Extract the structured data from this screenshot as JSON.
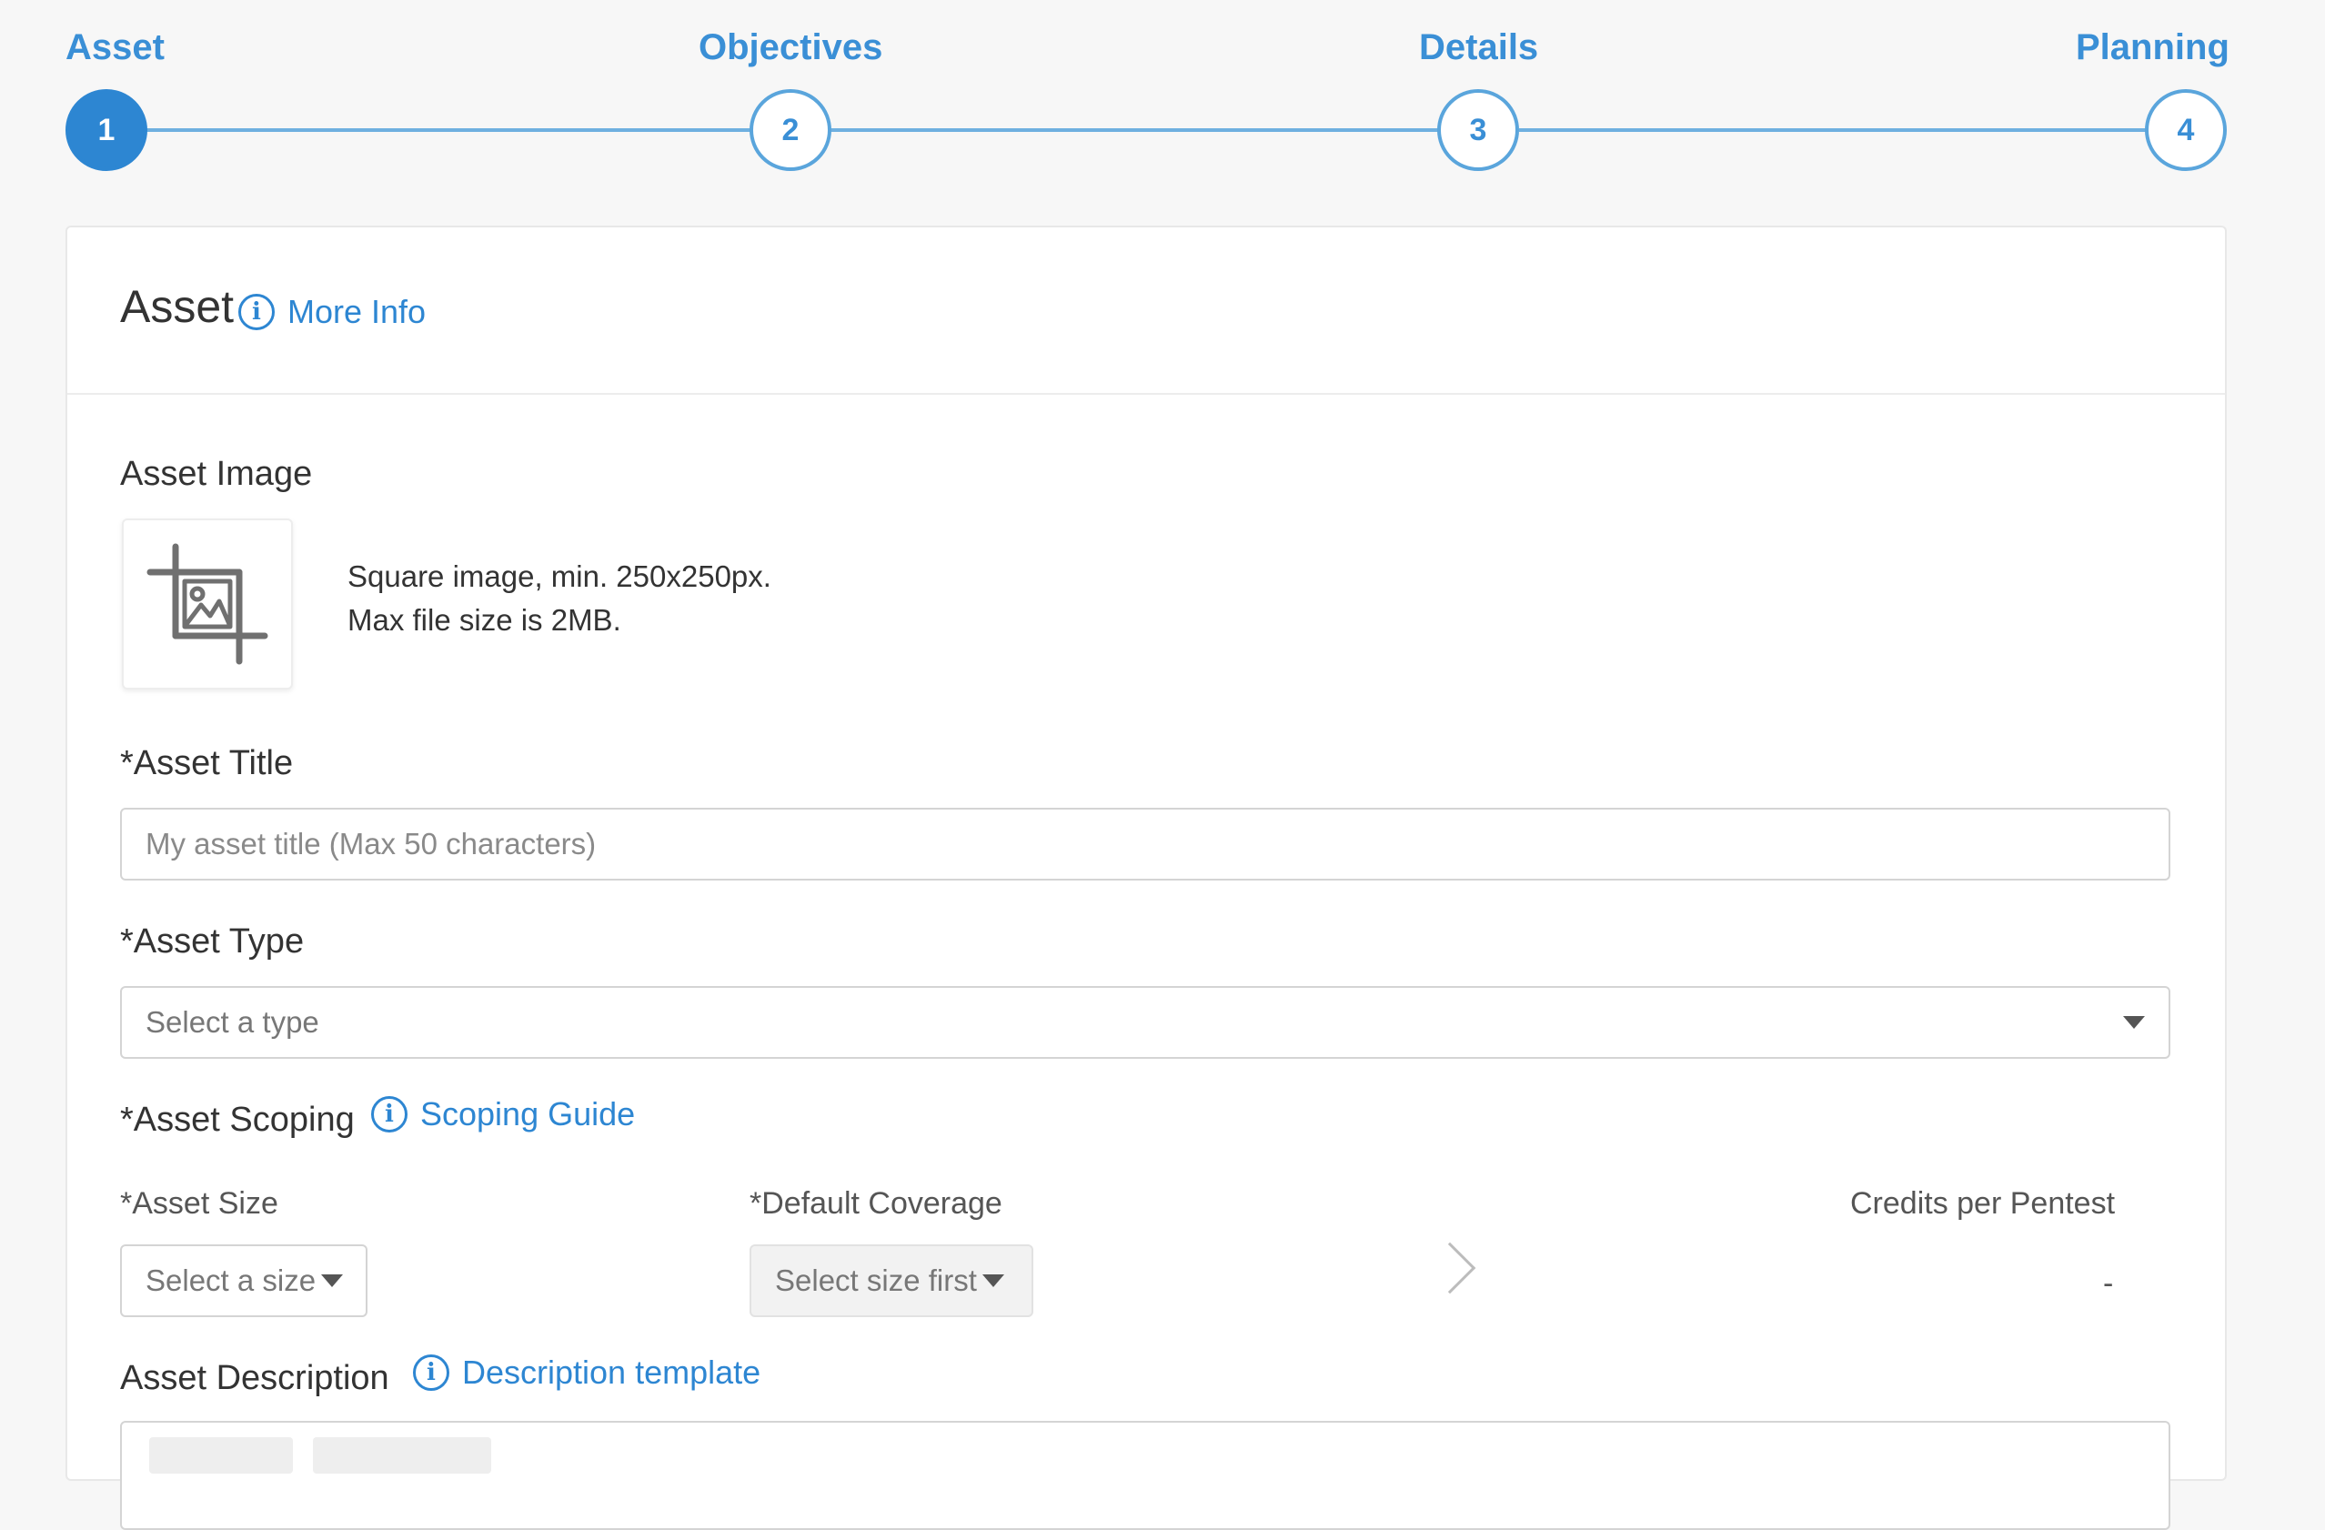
{
  "stepper": {
    "steps": [
      {
        "label": "Asset",
        "number": "1",
        "active": true
      },
      {
        "label": "Objectives",
        "number": "2",
        "active": false
      },
      {
        "label": "Details",
        "number": "3",
        "active": false
      },
      {
        "label": "Planning",
        "number": "4",
        "active": false
      }
    ],
    "colors": {
      "active": "#2d86d2",
      "line": "#6fb0e0",
      "label": "#3a8fd6"
    }
  },
  "card": {
    "title": "Asset",
    "more_info": "More Info"
  },
  "asset_image": {
    "label": "Asset Image",
    "hint_line1": "Square image, min. 250x250px.",
    "hint_line2": "Max file size is 2MB.",
    "icon": "image-crop-icon"
  },
  "asset_title": {
    "label": "*Asset Title",
    "placeholder": "My asset title (Max 50 characters)",
    "value": ""
  },
  "asset_type": {
    "label": "*Asset Type",
    "selected": "Select a type"
  },
  "asset_scoping": {
    "label": "*Asset Scoping",
    "guide_link": "Scoping Guide",
    "size_label": "*Asset Size",
    "size_selected": "Select a size",
    "coverage_label": "*Default Coverage",
    "coverage_selected": "Select size first",
    "credits_label": "Credits per Pentest",
    "credits_value": "-"
  },
  "asset_description": {
    "label": "Asset Description",
    "template_link": "Description template"
  }
}
